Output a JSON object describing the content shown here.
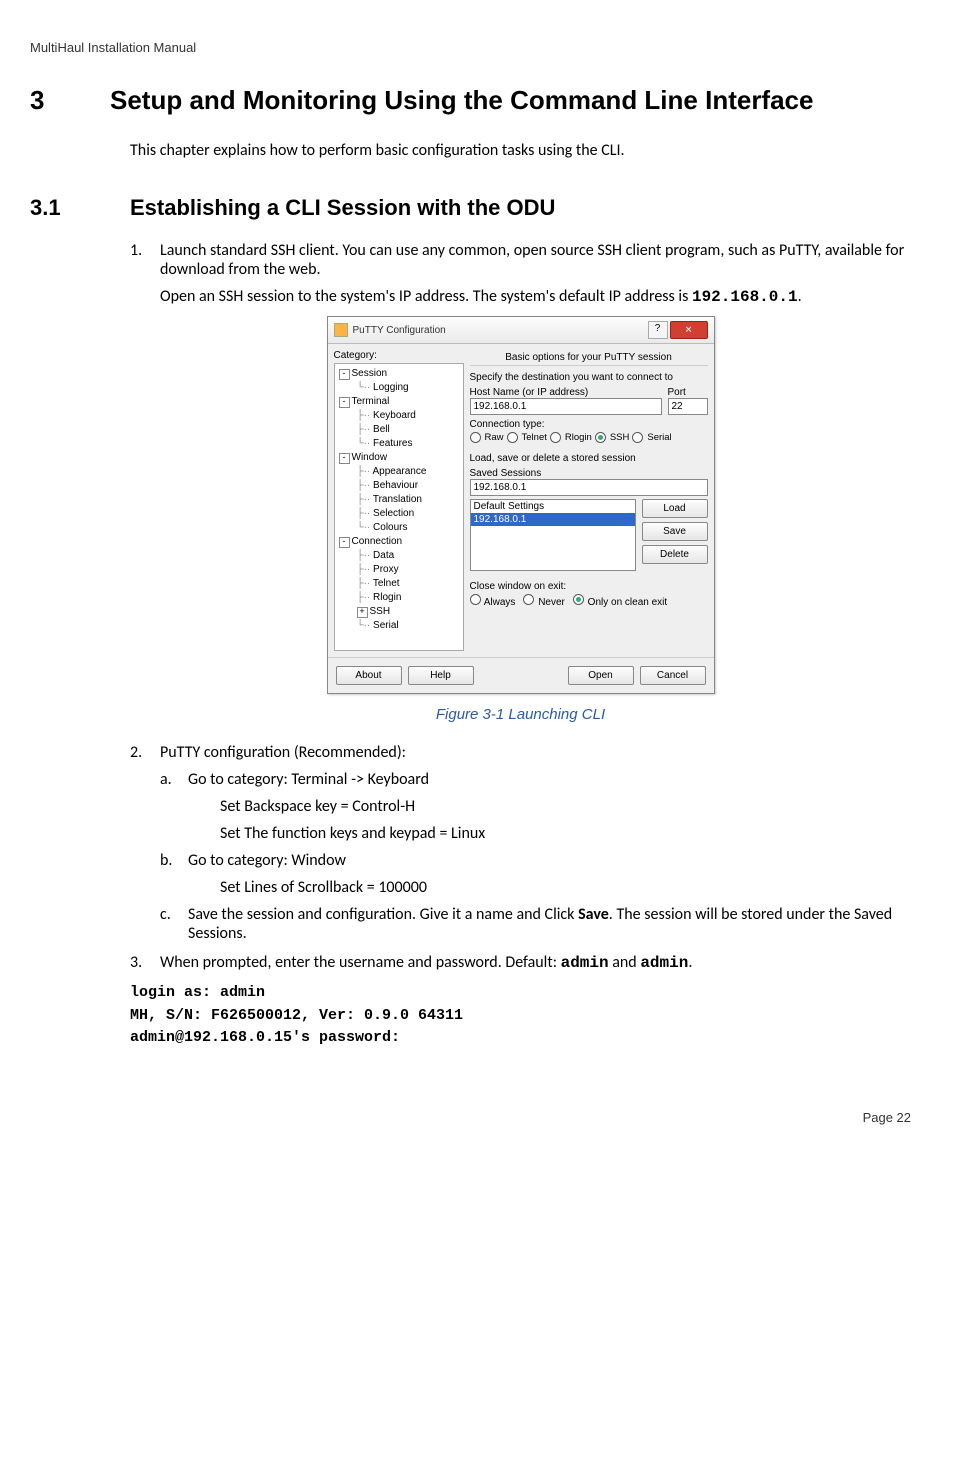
{
  "header": "MultiHaul Installation Manual",
  "chapter": {
    "num": "3",
    "title": "Setup and Monitoring Using the Command Line Interface",
    "intro": "This chapter explains how to perform basic configuration tasks using the CLI."
  },
  "section": {
    "num": "3.1",
    "title": "Establishing a CLI Session with the ODU"
  },
  "step1": {
    "num": "1.",
    "text": "Launch standard SSH client. You can use any common, open source SSH client program, such as PuTTY, available for download from the web.",
    "note_prefix": "Open an SSH session to the system's IP address. The system's default IP address is ",
    "ip": "192.168.0.1",
    "note_suffix": "."
  },
  "putty": {
    "title": "PuTTY Configuration",
    "category_label": "Category:",
    "tree": {
      "session": "Session",
      "logging": "Logging",
      "terminal": "Terminal",
      "keyboard": "Keyboard",
      "bell": "Bell",
      "features": "Features",
      "window": "Window",
      "appearance": "Appearance",
      "behaviour": "Behaviour",
      "translation": "Translation",
      "selection": "Selection",
      "colours": "Colours",
      "connection": "Connection",
      "data": "Data",
      "proxy": "Proxy",
      "telnet": "Telnet",
      "rlogin": "Rlogin",
      "ssh": "SSH",
      "serial": "Serial"
    },
    "panel_title": "Basic options for your PuTTY session",
    "dest_label": "Specify the destination you want to connect to",
    "host_label": "Host Name (or IP address)",
    "port_label": "Port",
    "host_value": "192.168.0.1",
    "port_value": "22",
    "conn_label": "Connection type:",
    "conn": {
      "raw": "Raw",
      "telnet": "Telnet",
      "rlogin": "Rlogin",
      "ssh": "SSH",
      "serial": "Serial"
    },
    "lsd_label": "Load, save or delete a stored session",
    "saved_label": "Saved Sessions",
    "saved_value": "192.168.0.1",
    "sess_default": "Default Settings",
    "sess_item": "192.168.0.1",
    "btn": {
      "load": "Load",
      "save": "Save",
      "delete": "Delete",
      "about": "About",
      "help": "Help",
      "open": "Open",
      "cancel": "Cancel"
    },
    "close_label": "Close window on exit:",
    "close": {
      "always": "Always",
      "never": "Never",
      "clean": "Only on clean exit"
    }
  },
  "figure_caption": "Figure 3-1 Launching CLI",
  "step2": {
    "num": "2.",
    "text": "PuTTY configuration (Recommended):",
    "a_num": "a.",
    "a_text": "Go to category: Terminal -> Keyboard",
    "a_set1": "Set Backspace key = Control-H",
    "a_set2": "Set The function keys and keypad = Linux",
    "b_num": "b.",
    "b_text": "Go to category: Window",
    "b_set1": "Set Lines of Scrollback = 100000",
    "c_num": "c.",
    "c_text_pre": "Save the session and configuration. Give it a name and Click ",
    "c_bold": "Save",
    "c_text_post": ". The session will be stored under the Saved Sessions."
  },
  "step3": {
    "num": "3.",
    "text_pre": "When prompted, enter the username and password. Default: ",
    "user": "admin",
    "and": " and ",
    "pass": "admin",
    "text_post": "."
  },
  "terminal": {
    "l1": "login as: admin",
    "l2": "MH, S/N: F626500012, Ver:  0.9.0 64311",
    "l3": "admin@192.168.0.15's password:"
  },
  "footer": "Page 22"
}
